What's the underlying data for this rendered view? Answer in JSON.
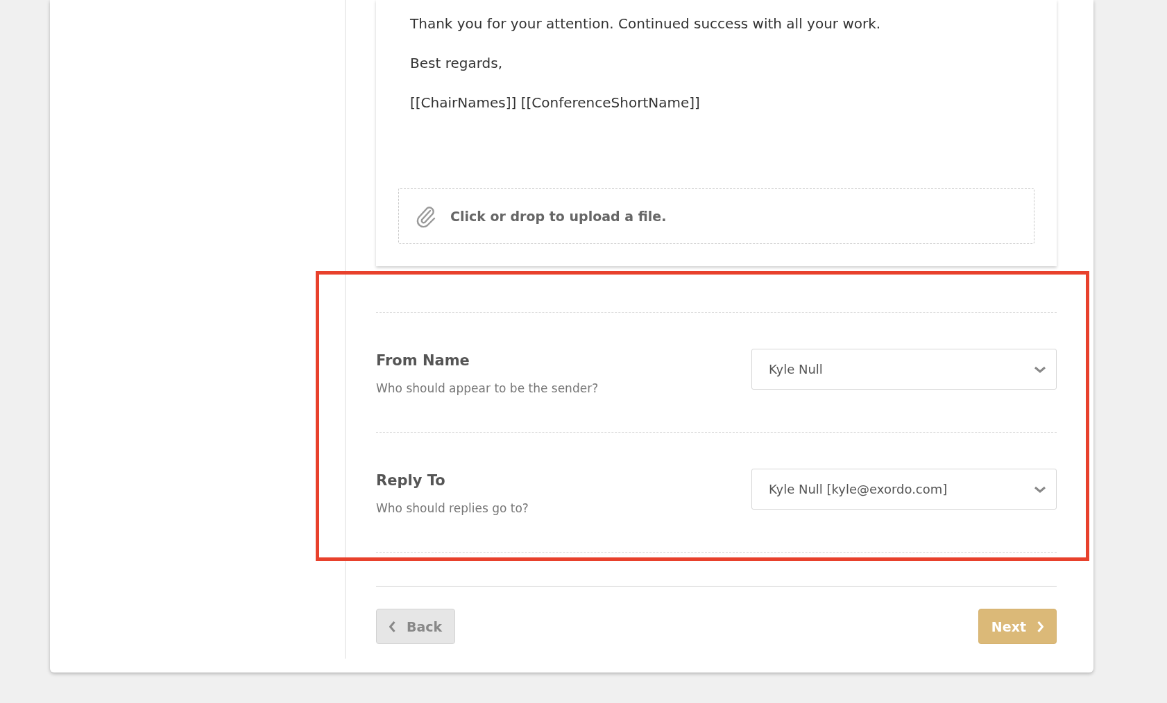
{
  "email_body": {
    "paragraphs": [
      "Thank you for your attention. Continued success with all your work.",
      "Best regards,",
      "[[ChairNames]] [[ConferenceShortName]]"
    ]
  },
  "attachment": {
    "label": "Click or drop to upload a file."
  },
  "fields": [
    {
      "label": "From Name",
      "hint": "Who should appear to be the sender?",
      "value": "Kyle Null"
    },
    {
      "label": "Reply To",
      "hint": "Who should replies go to?",
      "value": "Kyle Null [kyle@exordo.com]"
    }
  ],
  "buttons": [
    {
      "label": "Back",
      "kind": "back"
    },
    {
      "label": "Next",
      "kind": "next"
    }
  ]
}
